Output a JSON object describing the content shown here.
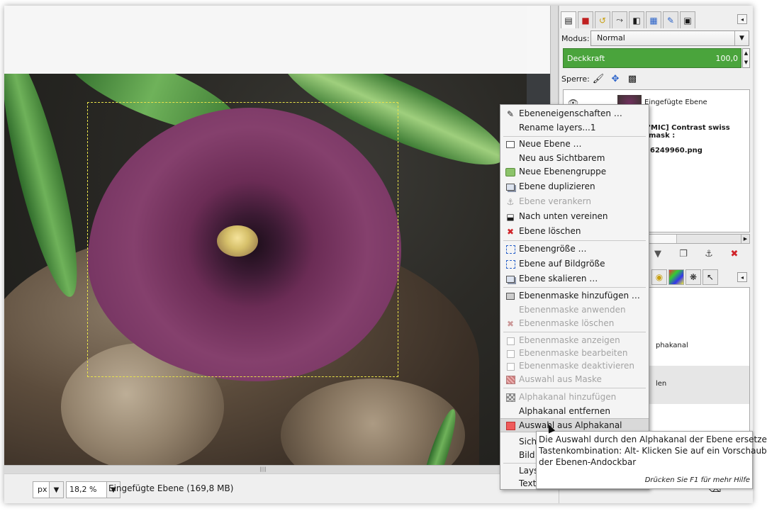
{
  "statusbar": {
    "unit": "px",
    "zoom": "18,2 %",
    "info": "Eingefügte Ebene (169,8 MB)"
  },
  "dock": {
    "tabs": [
      "layers-tab",
      "channels-tab",
      "paths-tab",
      "undo-tab",
      "colors-tab",
      "histogram-tab",
      "brushes-tab",
      "documents-tab"
    ],
    "mode_label": "Modus:",
    "mode_value": "Normal",
    "opacity_label": "Deckkraft",
    "opacity_value": "100,0",
    "lock_label": "Sperre:",
    "layers": [
      {
        "name": "Eingefügte Ebene"
      },
      {
        "name": "'MIC] Contrast swiss mask :"
      },
      {
        "name": "6249960.png"
      }
    ],
    "channels": [
      {
        "name": "phakanal"
      },
      {
        "name": "len"
      }
    ],
    "accent_green": "#4aa43c"
  },
  "context_menu": {
    "items": [
      {
        "label": "Ebeneneigenschaften …",
        "icon": "edit-icon",
        "disabled": false
      },
      {
        "label": "Rename layers...1",
        "icon": "",
        "disabled": false
      },
      {
        "label": "Neue Ebene …",
        "icon": "new-layer-icon",
        "disabled": false
      },
      {
        "label": "Neu aus Sichtbarem",
        "icon": "",
        "disabled": false
      },
      {
        "label": "Neue Ebenengruppe",
        "icon": "folder-icon",
        "disabled": false
      },
      {
        "label": "Ebene duplizieren",
        "icon": "duplicate-icon",
        "disabled": false
      },
      {
        "label": "Ebene verankern",
        "icon": "anchor-icon",
        "disabled": true
      },
      {
        "label": "Nach unten vereinen",
        "icon": "merge-down-icon",
        "disabled": false
      },
      {
        "label": "Ebene löschen",
        "icon": "delete-icon",
        "disabled": false
      },
      {
        "label": "Ebenengröße …",
        "icon": "layer-size-icon",
        "disabled": false
      },
      {
        "label": "Ebene auf Bildgröße",
        "icon": "layer-to-image-icon",
        "disabled": false
      },
      {
        "label": "Ebene skalieren …",
        "icon": "scale-icon",
        "disabled": false
      },
      {
        "label": "Ebenenmaske hinzufügen …",
        "icon": "add-mask-icon",
        "disabled": false
      },
      {
        "label": "Ebenenmaske anwenden",
        "icon": "",
        "disabled": true
      },
      {
        "label": "Ebenenmaske löschen",
        "icon": "delete-icon",
        "disabled": true
      },
      {
        "label": "Ebenenmaske anzeigen",
        "icon": "checkbox-icon",
        "disabled": true
      },
      {
        "label": "Ebenenmaske bearbeiten",
        "icon": "checkbox-icon",
        "disabled": true
      },
      {
        "label": "Ebenenmaske deaktivieren",
        "icon": "checkbox-icon",
        "disabled": true
      },
      {
        "label": "Auswahl aus Maske",
        "icon": "mask-selection-icon",
        "disabled": true
      },
      {
        "label": "Alphakanal hinzufügen",
        "icon": "alpha-icon",
        "disabled": true
      },
      {
        "label": "Alphakanal entfernen",
        "icon": "",
        "disabled": false
      },
      {
        "label": "Auswahl aus Alphakanal",
        "icon": "selection-icon",
        "disabled": false
      },
      {
        "label": "Sich",
        "icon": "",
        "disabled": false
      },
      {
        "label": "Bild",
        "icon": "",
        "disabled": false
      },
      {
        "label": "Lays",
        "icon": "",
        "disabled": false
      },
      {
        "label": "Text",
        "icon": "",
        "disabled": false
      }
    ]
  },
  "tooltip": {
    "line1": "Die Auswahl durch den Alphakanal der Ebene ersetzen",
    "line2": "Tastenkombination: Alt- Klicken Sie auf ein Vorschaubild",
    "line3": "der Ebenen-Andockbar",
    "help": "Drücken Sie F1 für mehr Hilfe"
  }
}
